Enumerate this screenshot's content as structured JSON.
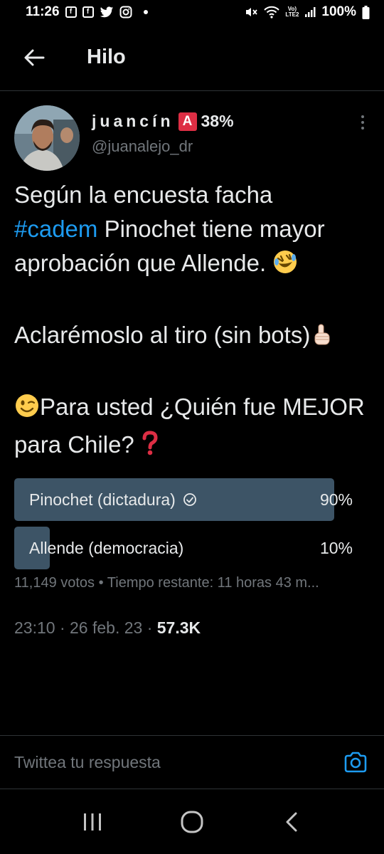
{
  "status_bar": {
    "time": "11:26",
    "left_icons": [
      "facebook-icon",
      "facebook-icon",
      "twitter-icon",
      "instagram-icon",
      "notification-dot-icon"
    ],
    "fb_letter": "f",
    "volte": "Vo)",
    "lte": "LTE2",
    "battery": "100%"
  },
  "header": {
    "title": "Hilo",
    "back_icon": "arrow-left-icon"
  },
  "tweet": {
    "display_name": "juancín",
    "badge": "A",
    "display_pct": "38%",
    "username": "@juanalejo_dr",
    "line1_pre": "Según la encuesta facha",
    "hashtag": "#cadem",
    "line1_post": " Pinochet tiene mayor aprobación que Allende. ",
    "line2": "Aclarémoslo al tiro (sin bots)",
    "line3": "Para usted ¿Quién fue MEJOR para Chile? ",
    "timestamp": "23:10 · 26 feb. 23 · ",
    "views": "57.3K"
  },
  "poll": {
    "options": [
      {
        "label": "Pinochet (dictadura)",
        "pct": "90%",
        "value": 0.9,
        "winner": true
      },
      {
        "label": "Allende (democracia)",
        "pct": "10%",
        "value": 0.1,
        "winner": false
      }
    ],
    "meta": "11,149 votos • Tiempo restante: 11 horas 43 m..."
  },
  "reply": {
    "placeholder": "Twittea tu respuesta",
    "camera_icon": "camera-icon"
  },
  "nav": {
    "icons": [
      "recent-apps-icon",
      "home-icon",
      "back-icon"
    ]
  },
  "colors": {
    "background": "#000000",
    "text": "#e7e9ea",
    "secondary": "#71767b",
    "accent": "#1d9bf0",
    "poll_bar": "#3d5466",
    "badge": "#dd2e44"
  }
}
